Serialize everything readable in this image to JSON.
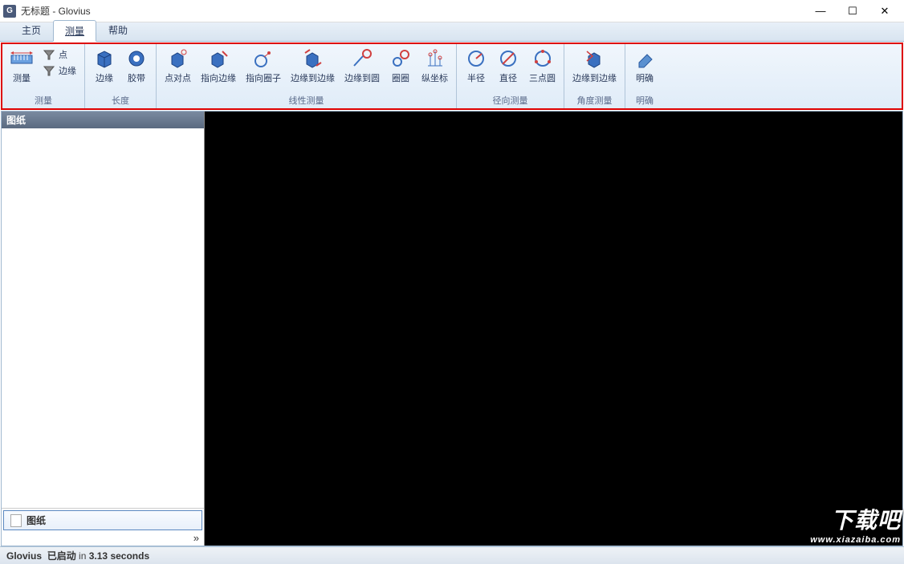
{
  "title": "无标题 - Glovius",
  "app_icon_letter": "G",
  "window": {
    "min": "—",
    "max": "☐",
    "close": "✕"
  },
  "tabs": {
    "home": "主页",
    "measure": "测量",
    "help": "帮助",
    "active": "measure"
  },
  "ribbon": {
    "measure_group": {
      "label": "测量",
      "measure_btn": "测量",
      "point_btn": "点",
      "edge_btn": "边缘"
    },
    "length_group": {
      "label": "长度",
      "edge_btn": "边缘",
      "tape_btn": "胶带"
    },
    "linear_group": {
      "label": "线性测量",
      "ptp_btn": "点对点",
      "to_edge_btn": "指向边缘",
      "to_circle_btn": "指向圈子",
      "edge_to_edge_btn": "边缘到边缘",
      "edge_to_circle_btn": "边缘到圆",
      "circle_btn": "圈圈",
      "ordinate_btn": "纵坐标"
    },
    "radial_group": {
      "label": "径向测量",
      "radius_btn": "半径",
      "diameter_btn": "直径",
      "three_pt_btn": "三点圆"
    },
    "angle_group": {
      "label": "角度测量",
      "edge_to_edge_btn": "边缘到边缘"
    },
    "clear_group": {
      "label": "明确",
      "clear_btn": "明确"
    }
  },
  "sidebar": {
    "panel_title": "图纸",
    "tab_label": "图纸",
    "toggle_glyph": "»"
  },
  "status": {
    "app": "Glovius",
    "started": "已启动",
    "in": "in",
    "time": "3.13",
    "seconds": "seconds"
  },
  "watermark": {
    "line1": "下载吧",
    "line2": "www.xiazaiba.com"
  }
}
